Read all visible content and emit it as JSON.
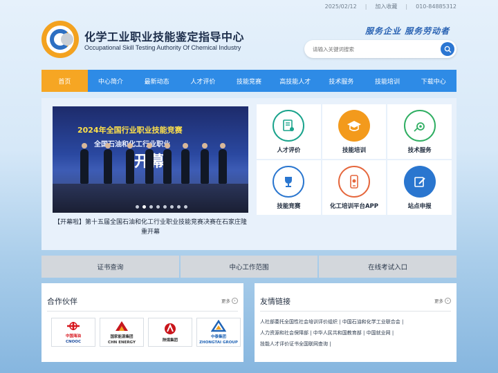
{
  "topbar": {
    "date": "2025/02/12",
    "favorite": "加入收藏",
    "phone": "010-84885312"
  },
  "header": {
    "title_cn": "化学工业职业技能鉴定指导中心",
    "title_en": "Occupational Skill Testing Authority Of Chemical Industry",
    "slogan": "服务企业  服务劳动者",
    "search": {
      "placeholder": "请输入关键词搜索"
    }
  },
  "nav": {
    "items": [
      {
        "label": "首页",
        "active": true
      },
      {
        "label": "中心简介"
      },
      {
        "label": "最新动态"
      },
      {
        "label": "人才评价"
      },
      {
        "label": "技能竞赛"
      },
      {
        "label": "高技能人才"
      },
      {
        "label": "技术服务"
      },
      {
        "label": "技能培训"
      },
      {
        "label": "下载中心"
      }
    ]
  },
  "slider": {
    "banner_line1": "2024年全国行业职业技能竞赛",
    "banner_line2": "全国石油和化工行业职业",
    "banner_big": "开幕",
    "caption": "【开幕啦】第十五届全国石油和化工行业职业技能竞赛决赛在石家庄隆重开幕",
    "active_dot": 1,
    "dot_count": 8
  },
  "quick_grid": [
    {
      "label": "人才评价",
      "icon": "certificate-icon",
      "color": "#1aa38c"
    },
    {
      "label": "技能培训",
      "icon": "graduation-cap-icon",
      "color": "#f39a1c"
    },
    {
      "label": "技术服务",
      "icon": "gear-tools-icon",
      "color": "#2fae62"
    },
    {
      "label": "技能竞赛",
      "icon": "trophy-icon",
      "color": "#2a76cf"
    },
    {
      "label": "化工培训平台APP",
      "icon": "mobile-app-icon",
      "color": "#e5673d"
    },
    {
      "label": "站点申报",
      "icon": "edit-icon",
      "color": "#2a76cf"
    }
  ],
  "quick_bar": [
    {
      "label": "证书查询"
    },
    {
      "label": "中心工作范围"
    },
    {
      "label": "在线考试入口"
    }
  ],
  "partners": {
    "title": "合作伙伴",
    "more": "更多",
    "items": [
      {
        "name": "中国海油",
        "sub": "CNOOC",
        "color": "#d7161d"
      },
      {
        "name": "国家能源集团",
        "sub": "CHN ENERGY",
        "color": "#c6171e"
      },
      {
        "name": "陕煤集团",
        "sub": "",
        "color": "#c9151b"
      },
      {
        "name": "中泰集团",
        "sub": "ZHONGTAI GROUP",
        "color": "#1f63b5"
      }
    ]
  },
  "links": {
    "title": "友情链接",
    "more": "更多",
    "items": [
      "人社部委托全国性社会培训评价组织",
      "中国石油和化学工业联合会",
      "人力资源和社会保障部",
      "中华人民共和国教育部",
      "中国就业网",
      "技能人才评价证书全国联网查询"
    ]
  }
}
